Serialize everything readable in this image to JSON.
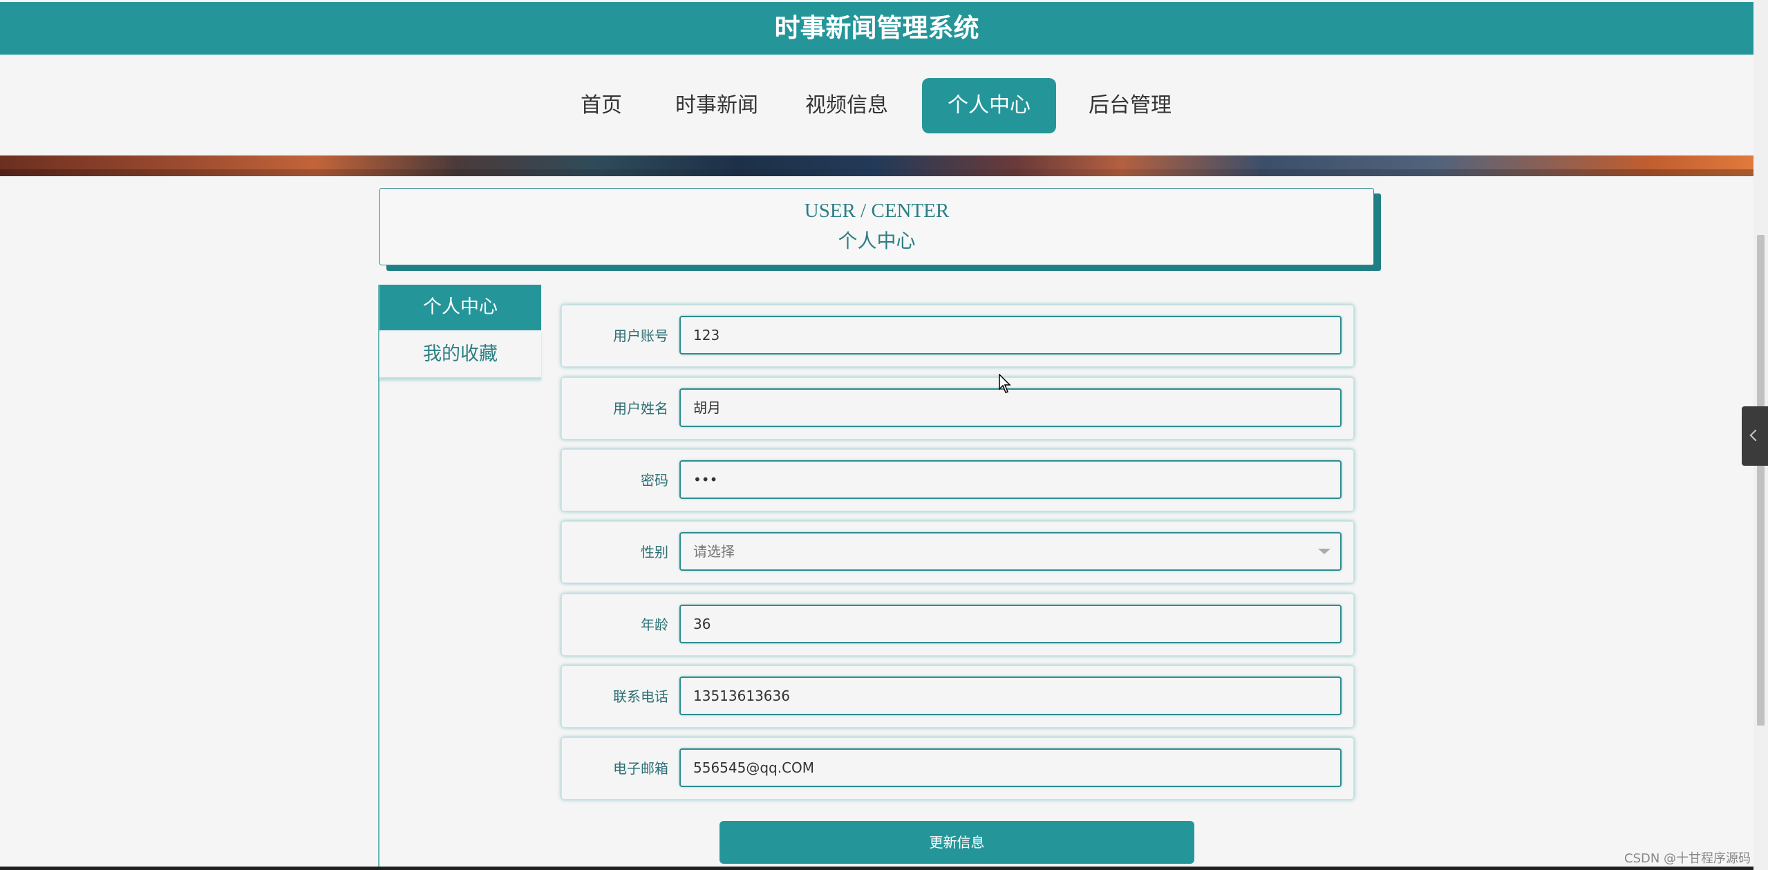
{
  "header": {
    "title": "时事新闻管理系统"
  },
  "nav": {
    "items": [
      {
        "label": "首页"
      },
      {
        "label": "时事新闻"
      },
      {
        "label": "视频信息"
      },
      {
        "label": "个人中心",
        "active": true
      },
      {
        "label": "后台管理"
      }
    ]
  },
  "section": {
    "title_en": "USER / CENTER",
    "title_cn": "个人中心"
  },
  "sidebar": {
    "items": [
      {
        "label": "个人中心",
        "active": true
      },
      {
        "label": "我的收藏"
      }
    ]
  },
  "form": {
    "fields": [
      {
        "label": "用户账号",
        "value": "123"
      },
      {
        "label": "用户姓名",
        "value": "胡月"
      },
      {
        "label": "密码",
        "value": "•••"
      },
      {
        "label": "性别",
        "placeholder": "请选择"
      },
      {
        "label": "年龄",
        "value": "36"
      },
      {
        "label": "联系电话",
        "value": "13513613636"
      },
      {
        "label": "电子邮箱",
        "value": "556545@qq.COM"
      }
    ],
    "submit_label": "更新信息"
  },
  "watermark": "CSDN @十甘程序源码",
  "colors": {
    "accent": "#24969a",
    "label": "#2b6f74"
  }
}
